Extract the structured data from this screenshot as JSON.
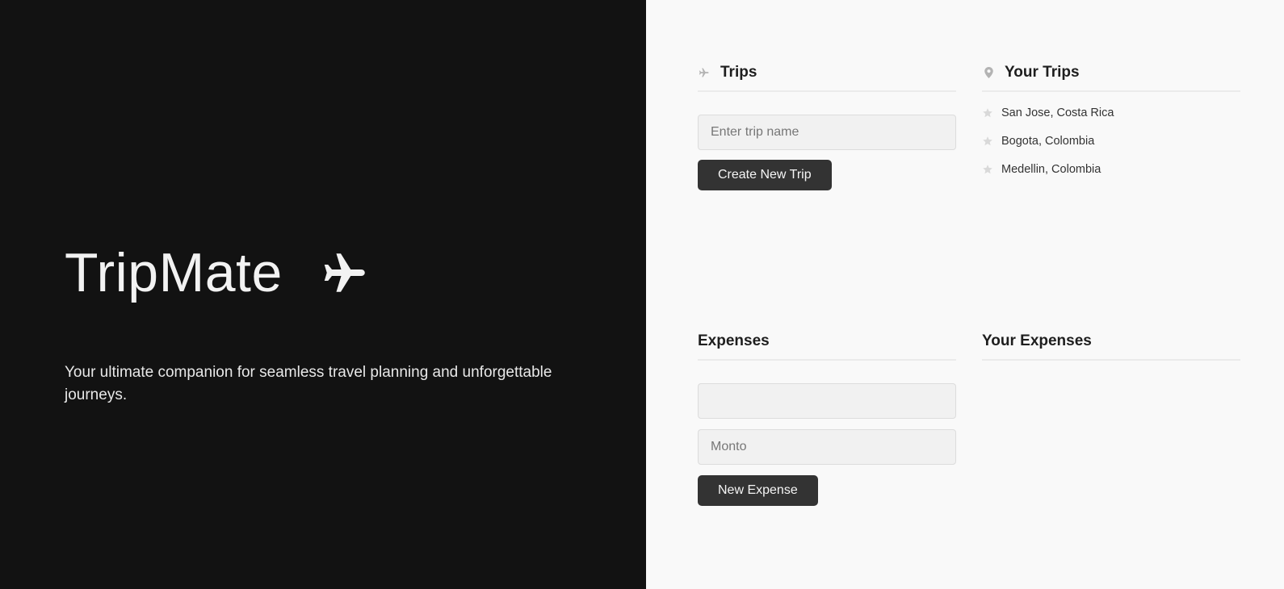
{
  "hero": {
    "title": "TripMate",
    "title_icon": "airplane-icon",
    "tagline": "Your ultimate companion for seamless travel planning and unforgettable journeys."
  },
  "trips": {
    "title": "Trips",
    "icon": "airplane-icon",
    "input_placeholder": "Enter trip name",
    "input_value": "",
    "create_button": "Create New Trip"
  },
  "your_trips": {
    "title": "Your Trips",
    "icon": "map-marker-icon",
    "item_icon": "star-icon",
    "items": [
      {
        "label": "San Jose, Costa Rica"
      },
      {
        "label": "Bogota, Colombia"
      },
      {
        "label": "Medellin, Colombia"
      }
    ]
  },
  "expenses": {
    "title": "Expenses",
    "name_input_placeholder": "",
    "name_input_value": "",
    "amount_input_placeholder": "Monto",
    "amount_input_value": "",
    "new_button": "New Expense"
  },
  "your_expenses": {
    "title": "Your Expenses",
    "items": []
  },
  "colors": {
    "hero_background": "#121212",
    "panel_background": "#f9f9f9",
    "button_background": "#333333",
    "icon_gray": "#b3b3b3",
    "star_gray": "#d9d9d9"
  }
}
